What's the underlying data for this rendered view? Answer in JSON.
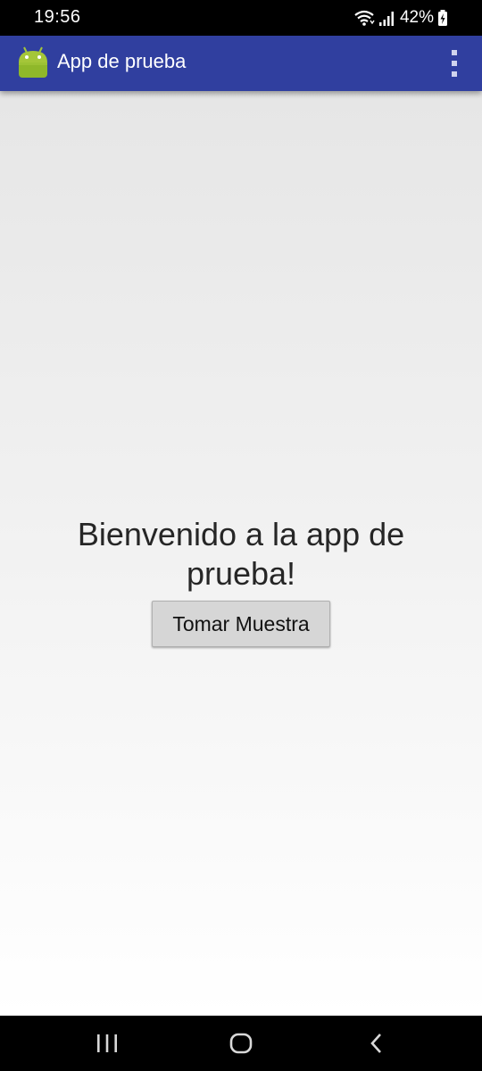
{
  "status_bar": {
    "time": "19:56",
    "battery": "42%",
    "icons": [
      "wifi-icon",
      "signal-icon",
      "battery-charging-icon"
    ]
  },
  "app_bar": {
    "title": "App de prueba",
    "app_icon": "android-icon",
    "menu_icon": "overflow-menu-icon",
    "color": "#303f9f"
  },
  "main": {
    "welcome_text": "Bienvenido a la app de prueba!",
    "button_label": "Tomar Muestra"
  },
  "nav_bar": {
    "icons": [
      "recent-apps-icon",
      "home-icon",
      "back-icon"
    ]
  }
}
